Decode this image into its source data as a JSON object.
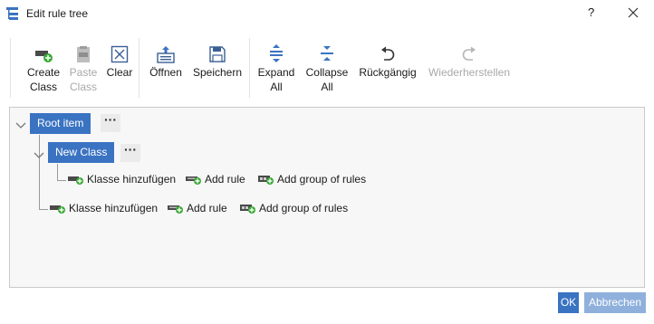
{
  "window": {
    "title": "Edit rule tree",
    "help_label": "?"
  },
  "toolbar": {
    "create_class": [
      "Create",
      "Class"
    ],
    "paste_class": [
      "Paste",
      "Class"
    ],
    "clear": "Clear",
    "open": "Öffnen",
    "save": "Speichern",
    "expand_all": [
      "Expand",
      "All"
    ],
    "collapse_all": [
      "Collapse",
      "All"
    ],
    "undo": "Rückgängig",
    "redo": "Wiederherstellen"
  },
  "tree": {
    "root_label": "Root item",
    "more_label": "···",
    "child_label": "New Class",
    "child_actions": {
      "add_class": "Klasse hinzufügen",
      "add_rule": "Add rule",
      "add_group": "Add group of rules"
    },
    "root_actions": {
      "add_class": "Klasse hinzufügen",
      "add_rule": "Add rule",
      "add_group": "Add group of rules"
    }
  },
  "footer": {
    "ok_label": "OK",
    "cancel_label": "Abbrechen"
  },
  "colors": {
    "accent": "#3a73c2",
    "accent_disabled": "#8fb0dc",
    "add_green": "#3aa935",
    "redo_disabled": "#a9a9a9"
  }
}
